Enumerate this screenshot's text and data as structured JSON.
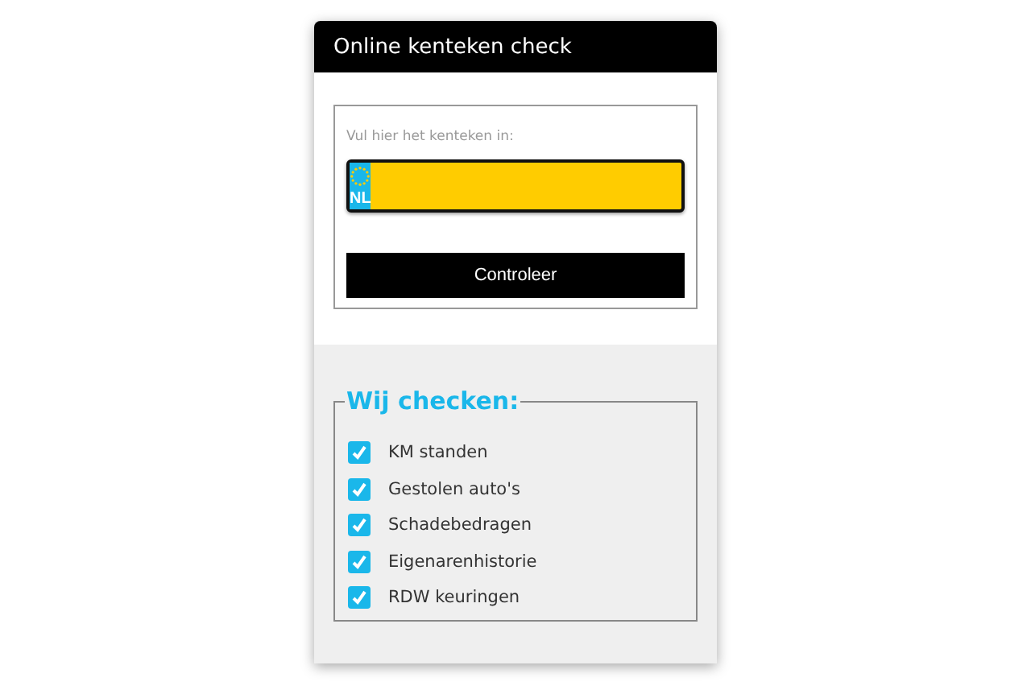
{
  "window": {
    "title": "Online kenteken check"
  },
  "form": {
    "label": "Vul hier het kenteken in:",
    "country": "NL",
    "button": "Controleer"
  },
  "checks": {
    "title": "Wij checken:",
    "items": [
      {
        "label": "KM standen",
        "checked": true
      },
      {
        "label": "Gestolen auto's",
        "checked": true
      },
      {
        "label": "Schadebedragen",
        "checked": true
      },
      {
        "label": "Eigenarenhistorie",
        "checked": true
      },
      {
        "label": "RDW keuringen",
        "checked": true
      }
    ]
  }
}
